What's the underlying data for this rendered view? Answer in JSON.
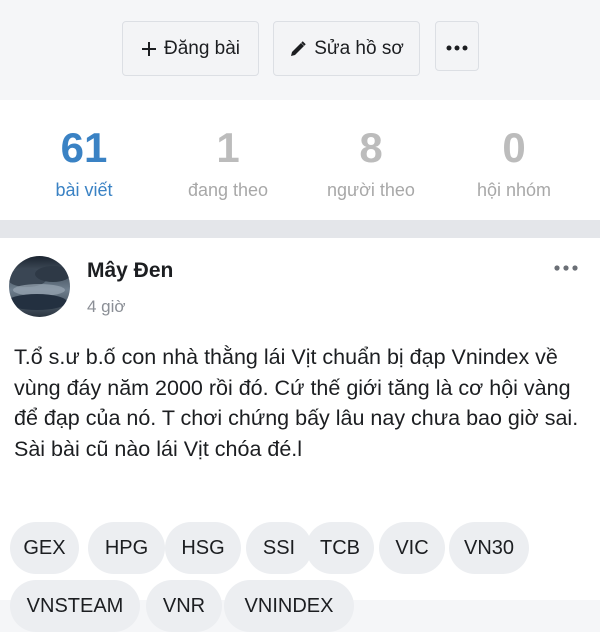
{
  "actions": {
    "post_label": "Đăng bài",
    "edit_label": "Sửa hồ sơ"
  },
  "stats": [
    {
      "value": "61",
      "label": "bài viết"
    },
    {
      "value": "1",
      "label": "đang theo"
    },
    {
      "value": "8",
      "label": "người theo"
    },
    {
      "value": "0",
      "label": "hội nhóm"
    }
  ],
  "post": {
    "author": "Mây Đen",
    "time": "4 giờ",
    "content": "T.ổ  s.ư  b.ố con nhà thằng lái Vịt chuẩn bị đạp Vnindex về vùng đáy năm 2000 rồi đó. Cứ thế giới tăng là cơ hội vàng để đạp của nó. T chơi chứng bấy lâu nay chưa bao giờ sai. Sài bài cũ nào lái Vịt chóa đé.l",
    "tags": [
      "GEX",
      "HPG",
      "HSG",
      "SSI",
      "TCB",
      "VIC",
      "VN30",
      "VNSTEAM",
      "VNR",
      "VNINDEX"
    ]
  },
  "colors": {
    "accent": "#3a82c4",
    "muted": "#bcbcbc"
  }
}
